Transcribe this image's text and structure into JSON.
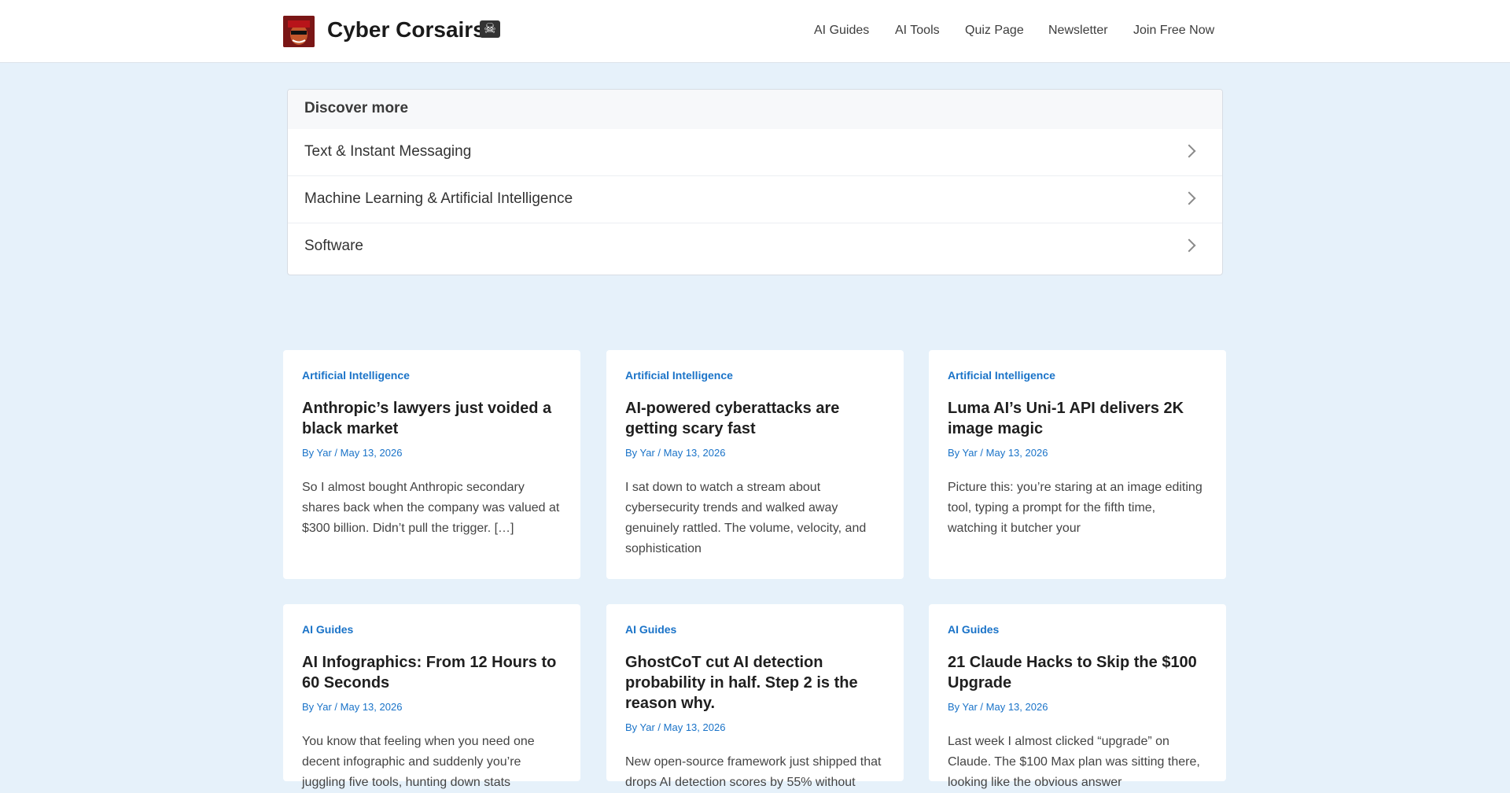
{
  "header": {
    "site_title": "Cyber Corsairs",
    "logo_icon": "pirate-avatar-icon",
    "skull_icon": "skull-crossbones-icon",
    "skull_glyph": "☠",
    "nav": [
      "AI Guides",
      "AI Tools",
      "Quiz Page",
      "Newsletter",
      "Join Free Now"
    ]
  },
  "discover": {
    "title": "Discover more",
    "items": [
      "Text & Instant Messaging",
      "Machine Learning & Artificial Intelligence",
      "Software"
    ]
  },
  "posts": [
    {
      "category": "Artificial Intelligence",
      "title": "Anthropic’s lawyers just voided a black market",
      "meta": "By Yar / May 13, 2026",
      "excerpt": "So I almost bought Anthropic secondary shares back when the company was valued at $300 billion. Didn’t pull the trigger. […]"
    },
    {
      "category": "Artificial Intelligence",
      "title": "AI-powered cyberattacks are getting scary fast",
      "meta": "By Yar / May 13, 2026",
      "excerpt": "I sat down to watch a stream about cybersecurity trends and walked away genuinely rattled. The volume, velocity, and sophistication"
    },
    {
      "category": "Artificial Intelligence",
      "title": "Luma AI’s Uni-1 API delivers 2K image magic",
      "meta": "By Yar / May 13, 2026",
      "excerpt": "Picture this: you’re staring at an image editing tool, typing a prompt for the fifth time, watching it butcher your"
    },
    {
      "category": "AI Guides",
      "title": "AI Infographics: From 12 Hours to 60 Seconds",
      "meta": "By Yar / May 13, 2026",
      "excerpt": "You know that feeling when you need one decent infographic and suddenly you’re juggling five tools, hunting down stats"
    },
    {
      "category": "AI Guides",
      "title": "GhostCoT cut AI detection probability in half. Step 2 is the reason why.",
      "meta": "By Yar / May 13, 2026",
      "excerpt": "New open-source framework just shipped that drops AI detection scores by 55% without"
    },
    {
      "category": "AI Guides",
      "title": "21 Claude Hacks to Skip the $100 Upgrade",
      "meta": "By Yar / May 13, 2026",
      "excerpt": "Last week I almost clicked “upgrade” on Claude. The $100 Max plan was sitting there, looking like the obvious answer"
    }
  ],
  "colors": {
    "page_bg": "#e6f1fa",
    "accent": "#1a73c8"
  }
}
